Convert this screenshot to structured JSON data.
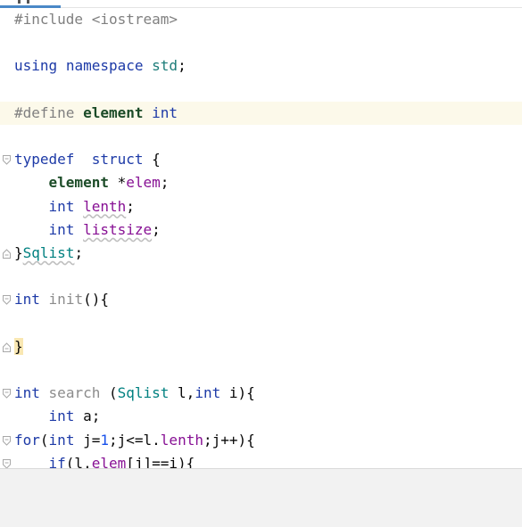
{
  "editor": {
    "lines": [
      {
        "tokens": [
          {
            "t": "#include <iostream>",
            "c": "tok-pre"
          }
        ],
        "fold": ""
      },
      {
        "tokens": [],
        "fold": ""
      },
      {
        "tokens": [
          {
            "t": "using",
            "c": "tok-kw"
          },
          {
            "t": " "
          },
          {
            "t": "namespace",
            "c": "tok-kw"
          },
          {
            "t": " "
          },
          {
            "t": "std",
            "c": "tok-std"
          },
          {
            "t": ";"
          }
        ],
        "fold": ""
      },
      {
        "tokens": [],
        "fold": ""
      },
      {
        "tokens": [
          {
            "t": "#define",
            "c": "tok-pre"
          },
          {
            "t": " "
          },
          {
            "t": "element",
            "c": "tok-macro"
          },
          {
            "t": " "
          },
          {
            "t": "int",
            "c": "tok-kw"
          }
        ],
        "fold": "",
        "highlight": true
      },
      {
        "tokens": [],
        "fold": ""
      },
      {
        "tokens": [
          {
            "t": "typedef",
            "c": "tok-kw"
          },
          {
            "t": "  "
          },
          {
            "t": "struct",
            "c": "tok-kw"
          },
          {
            "t": " {"
          }
        ],
        "fold": "open"
      },
      {
        "tokens": [
          {
            "t": "    "
          },
          {
            "t": "element",
            "c": "tok-macro"
          },
          {
            "t": " *"
          },
          {
            "t": "elem",
            "c": "tok-field"
          },
          {
            "t": ";"
          }
        ],
        "fold": ""
      },
      {
        "tokens": [
          {
            "t": "    "
          },
          {
            "t": "int",
            "c": "tok-kw"
          },
          {
            "t": " "
          },
          {
            "t": "lenth",
            "c": "tok-field wavy"
          },
          {
            "t": ";"
          }
        ],
        "fold": ""
      },
      {
        "tokens": [
          {
            "t": "    "
          },
          {
            "t": "int",
            "c": "tok-kw"
          },
          {
            "t": " "
          },
          {
            "t": "listsize",
            "c": "tok-field wavy"
          },
          {
            "t": ";"
          }
        ],
        "fold": ""
      },
      {
        "tokens": [
          {
            "t": "}"
          },
          {
            "t": "Sqlist",
            "c": "tok-struct wavy"
          },
          {
            "t": ";"
          }
        ],
        "fold": "close"
      },
      {
        "tokens": [],
        "fold": ""
      },
      {
        "tokens": [
          {
            "t": "int",
            "c": "tok-kw"
          },
          {
            "t": " "
          },
          {
            "t": "init",
            "c": "tok-gray"
          },
          {
            "t": "(){"
          }
        ],
        "fold": "open"
      },
      {
        "tokens": [],
        "fold": ""
      },
      {
        "tokens": [
          {
            "t": "}",
            "c": "bracket"
          }
        ],
        "fold": "close"
      },
      {
        "tokens": [],
        "fold": ""
      },
      {
        "tokens": [
          {
            "t": "int",
            "c": "tok-kw"
          },
          {
            "t": " "
          },
          {
            "t": "search",
            "c": "tok-gray"
          },
          {
            "t": " ("
          },
          {
            "t": "Sqlist",
            "c": "tok-struct"
          },
          {
            "t": " l,"
          },
          {
            "t": "int",
            "c": "tok-kw"
          },
          {
            "t": " i){"
          }
        ],
        "fold": "open"
      },
      {
        "tokens": [
          {
            "t": "    "
          },
          {
            "t": "int",
            "c": "tok-kw"
          },
          {
            "t": " a;"
          }
        ],
        "fold": ""
      },
      {
        "tokens": [
          {
            "t": "for",
            "c": "tok-kw"
          },
          {
            "t": "("
          },
          {
            "t": "int",
            "c": "tok-kw"
          },
          {
            "t": " j="
          },
          {
            "t": "1",
            "c": "tok-num"
          },
          {
            "t": ";j<=l."
          },
          {
            "t": "lenth",
            "c": "tok-field"
          },
          {
            "t": ";j++){",
            "c": ""
          }
        ],
        "fold": "open"
      },
      {
        "tokens": [
          {
            "t": "    "
          },
          {
            "t": "if",
            "c": "tok-kw"
          },
          {
            "t": "(l."
          },
          {
            "t": "elem",
            "c": "tok-field"
          },
          {
            "t": "[j]==i){"
          }
        ],
        "fold": "open"
      }
    ]
  },
  "colors": {
    "accent": "#4a88c7",
    "line_highlight": "#fcf9ea",
    "keyword": "#1d3aa7"
  }
}
